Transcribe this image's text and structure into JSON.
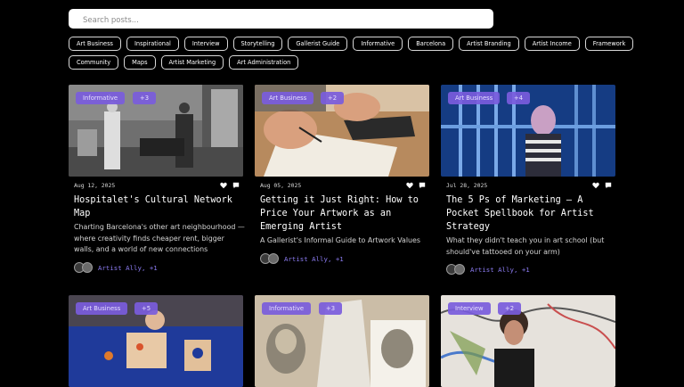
{
  "search": {
    "placeholder": "Search posts..."
  },
  "tags": {
    "row1": [
      "Art Business",
      "Inspirational",
      "Interview",
      "Storytelling",
      "Gallerist Guide",
      "Informative",
      "Barcelona",
      "Artist Branding",
      "Artist Income",
      "Framework"
    ],
    "row2": [
      "Community",
      "Maps",
      "Artist Marketing",
      "Art Administration"
    ]
  },
  "cards": [
    {
      "category": "Informative",
      "extra": "+3",
      "date": "Aug 12, 2025",
      "title": "Hospitalet's Cultural Network Map",
      "excerpt": "Charting Barcelona's other art neighbourhood — where creativity finds cheaper rent, bigger walls, and a world of new connections",
      "authors": "Artist Ally, +1"
    },
    {
      "category": "Art Business",
      "extra": "+2",
      "date": "Aug 05, 2025",
      "title": "Getting it Just Right: How to Price Your Artwork as an Emerging Artist",
      "excerpt": "A Gallerist's Informal Guide to Artwork Values",
      "authors": "Artist Ally, +1"
    },
    {
      "category": "Art Business",
      "extra": "+4",
      "date": "Jul 28, 2025",
      "title": "The 5 Ps of Marketing — A Pocket Spellbook for Artist Strategy",
      "excerpt": "What they didn't teach you in art school (but should've tattooed on your arm)",
      "authors": "Artist Ally, +1"
    },
    {
      "category": "Art Business",
      "extra": "+5"
    },
    {
      "category": "Informative",
      "extra": "+3"
    },
    {
      "category": "Interview",
      "extra": "+2"
    }
  ],
  "icons": {
    "like": "heart-icon",
    "comment": "comment-icon"
  },
  "colors": {
    "accent": "#7a5cdc",
    "author_link": "#8b7bf0",
    "background": "#000000"
  }
}
